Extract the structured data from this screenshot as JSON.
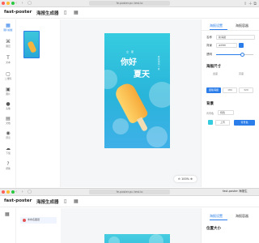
{
  "browser": {
    "url": "fe.poster.pc-test.io",
    "tab_title": "fast-poster 海报生",
    "nav_glyphs": "‹ › ▢",
    "right_glyphs": "⇪ ＋ ⧉"
  },
  "app": {
    "title": "fast-poster",
    "subtitle": "海报生成器"
  },
  "sidebar": {
    "items": [
      {
        "icon": "▦",
        "label": "图片模板"
      },
      {
        "icon": "⌘",
        "label": "图层"
      },
      {
        "icon": "T",
        "label": "文本"
      },
      {
        "icon": "▢",
        "label": "二维码"
      },
      {
        "icon": "▣",
        "label": "图片"
      },
      {
        "icon": "●",
        "label": "头像"
      },
      {
        "icon": "▤",
        "label": "文档"
      },
      {
        "icon": "◉",
        "label": "预览"
      },
      {
        "icon": "☁",
        "label": "下载"
      },
      {
        "icon": "?",
        "label": "帮助"
      }
    ]
  },
  "poster": {
    "line1": "你好",
    "line2": "夏天",
    "small_text": "立 夏",
    "vertical_text": "夏日清凉一夏"
  },
  "zoom": {
    "label": "100%"
  },
  "props": {
    "tab_active": "海报设置",
    "tab_other": "海报容器",
    "name_label": "名称",
    "name_value": "新海报",
    "bg_label": "背景",
    "bg_value": "#ffffff",
    "opacity_label": "透明",
    "opacity_percent": 70,
    "size_title": "海报尺寸",
    "size_w_label": "宽度",
    "size_h_label": "高度",
    "size_btn_active": "竖版海报",
    "size_btn_2": "180",
    "size_btn_3": "320",
    "bg_title": "背景",
    "bg_mode_label": "背景色",
    "bg_mode_value": "纯色",
    "upload_label": "上传",
    "confirm_label": "背景色"
  },
  "window2": {
    "layer_label": "未命名图层",
    "tab_active": "海报设置",
    "tab_other": "海报容器",
    "section": "位置大小"
  },
  "colors": {
    "accent": "#2b7de9",
    "poster_top": "#36cce0",
    "poster_bottom": "#3fb0e8",
    "popsicle": "#f6b43f"
  }
}
